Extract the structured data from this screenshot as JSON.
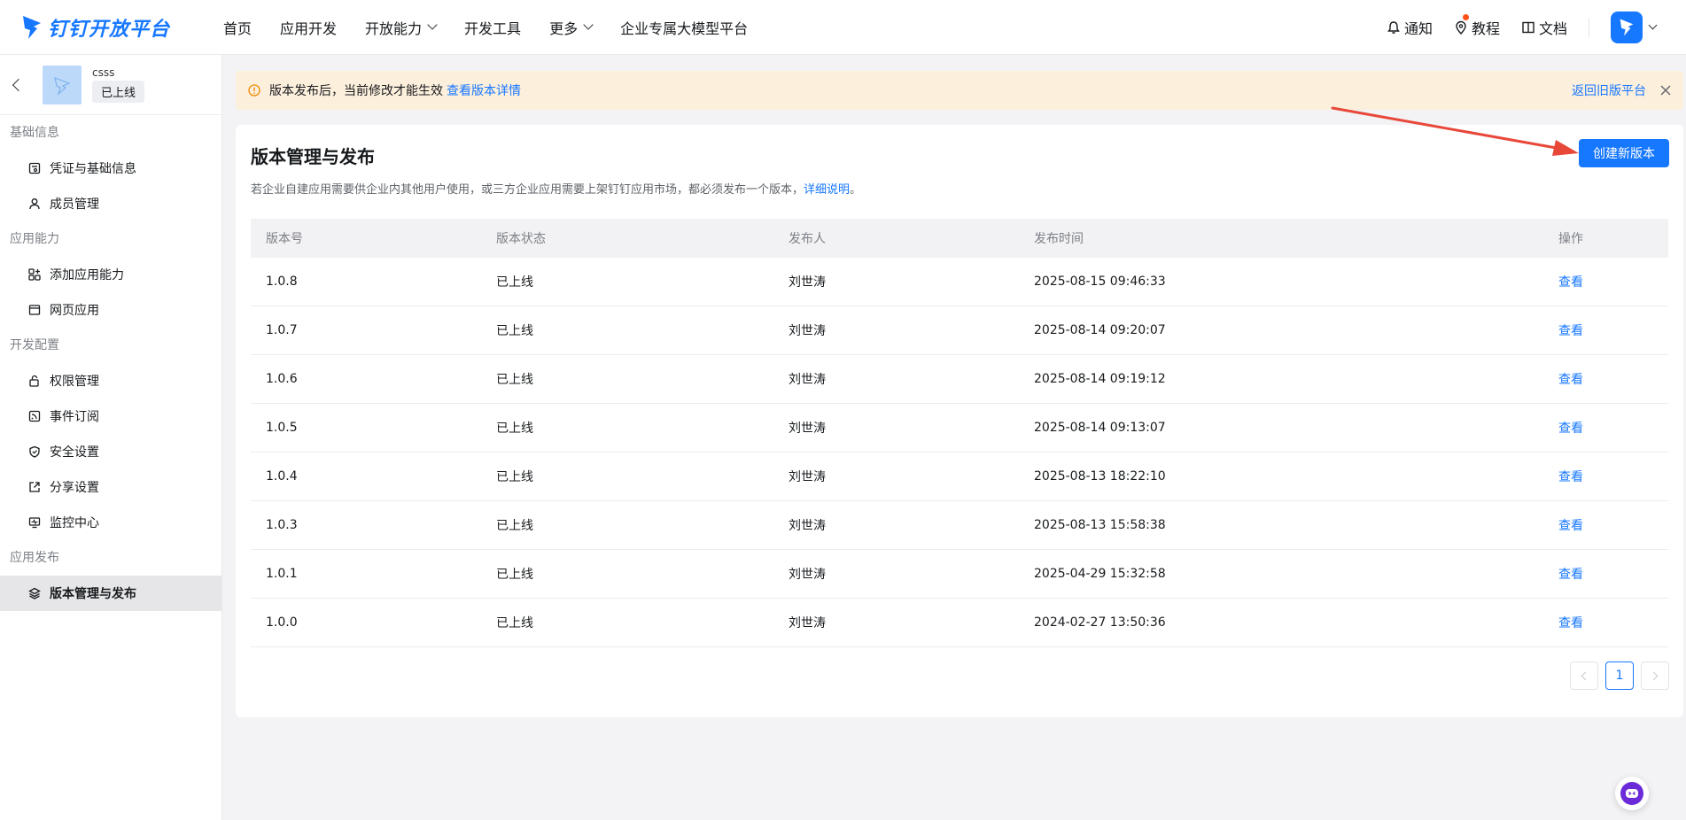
{
  "header": {
    "logo_text": "钉钉开放平台",
    "nav": [
      {
        "label": "首页",
        "dropdown": false
      },
      {
        "label": "应用开发",
        "dropdown": false
      },
      {
        "label": "开放能力",
        "dropdown": true
      },
      {
        "label": "开发工具",
        "dropdown": false
      },
      {
        "label": "更多",
        "dropdown": true
      },
      {
        "label": "企业专属大模型平台",
        "dropdown": false
      }
    ],
    "notify_label": "通知",
    "tutorial_label": "教程",
    "docs_label": "文档"
  },
  "sidebar": {
    "app_name": "csss",
    "app_status": "已上线",
    "groups": [
      {
        "title": "基础信息",
        "items": [
          {
            "label": "凭证与基础信息",
            "icon": "credential-icon"
          },
          {
            "label": "成员管理",
            "icon": "user-icon"
          }
        ]
      },
      {
        "title": "应用能力",
        "items": [
          {
            "label": "添加应用能力",
            "icon": "add-ability-icon"
          },
          {
            "label": "网页应用",
            "icon": "webpage-icon"
          }
        ]
      },
      {
        "title": "开发配置",
        "items": [
          {
            "label": "权限管理",
            "icon": "lock-icon"
          },
          {
            "label": "事件订阅",
            "icon": "rss-icon"
          },
          {
            "label": "安全设置",
            "icon": "shield-icon"
          },
          {
            "label": "分享设置",
            "icon": "share-icon"
          },
          {
            "label": "监控中心",
            "icon": "monitor-icon"
          }
        ]
      },
      {
        "title": "应用发布",
        "items": [
          {
            "label": "版本管理与发布",
            "icon": "layers-icon",
            "active": true
          }
        ]
      }
    ]
  },
  "notice": {
    "text": "版本发布后，当前修改才能生效",
    "link": "查看版本详情",
    "back_old": "返回旧版平台"
  },
  "main": {
    "title": "版本管理与发布",
    "desc": "若企业自建应用需要供企业内其他用户使用，或三方企业应用需要上架钉钉应用市场，都必须发布一个版本，",
    "desc_link": "详细说明",
    "desc_end": "。",
    "create_button": "创建新版本",
    "columns": [
      "版本号",
      "版本状态",
      "发布人",
      "发布时间",
      "操作"
    ],
    "rows": [
      {
        "version": "1.0.8",
        "status": "已上线",
        "publisher": "刘世涛",
        "time": "2025-08-15 09:46:33",
        "action": "查看"
      },
      {
        "version": "1.0.7",
        "status": "已上线",
        "publisher": "刘世涛",
        "time": "2025-08-14 09:20:07",
        "action": "查看"
      },
      {
        "version": "1.0.6",
        "status": "已上线",
        "publisher": "刘世涛",
        "time": "2025-08-14 09:19:12",
        "action": "查看"
      },
      {
        "version": "1.0.5",
        "status": "已上线",
        "publisher": "刘世涛",
        "time": "2025-08-14 09:13:07",
        "action": "查看"
      },
      {
        "version": "1.0.4",
        "status": "已上线",
        "publisher": "刘世涛",
        "time": "2025-08-13 18:22:10",
        "action": "查看"
      },
      {
        "version": "1.0.3",
        "status": "已上线",
        "publisher": "刘世涛",
        "time": "2025-08-13 15:58:38",
        "action": "查看"
      },
      {
        "version": "1.0.1",
        "status": "已上线",
        "publisher": "刘世涛",
        "time": "2025-04-29 15:32:58",
        "action": "查看"
      },
      {
        "version": "1.0.0",
        "status": "已上线",
        "publisher": "刘世涛",
        "time": "2024-02-27 13:50:36",
        "action": "查看"
      }
    ],
    "pagination": {
      "current": "1"
    }
  },
  "colors": {
    "accent": "#1677ff",
    "notice_bg": "#fcefdc",
    "annotation": "#e8483a"
  }
}
